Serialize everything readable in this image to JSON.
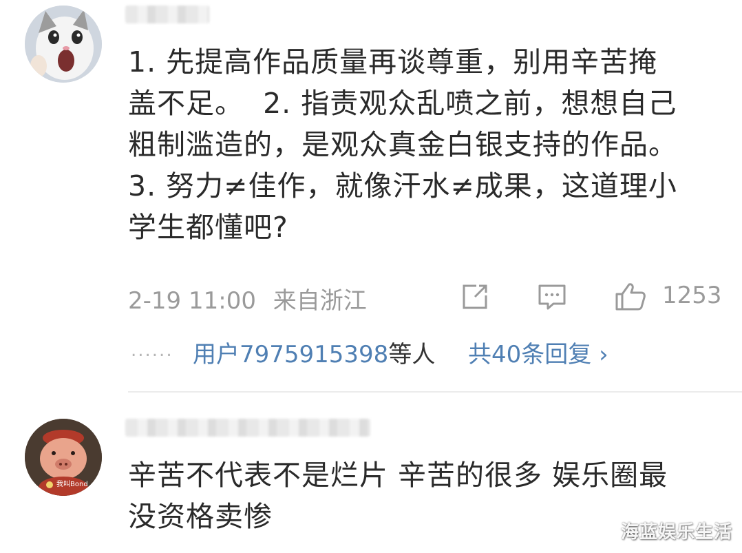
{
  "comments": [
    {
      "avatar": "cat-avatar",
      "text": "1. 先提高作品质量再谈尊重，别用辛苦掩\n盖不足。  2. 指责观众乱喷之前，想想自己\n粗制滥造的，是观众真金白银支持的作品。\n3. 努力≠佳作，就像汗水≠成果，这道理小\n学生都懂吧?",
      "date": "2-19 11:00",
      "location": "来自浙江",
      "like_count": "1253",
      "replies": {
        "dots": "......",
        "users_link": "用户7975915398",
        "users_suffix": "等人",
        "count_label": "共40条回复 ›"
      }
    },
    {
      "avatar": "cartoon-pig-avatar",
      "avatar_caption": "我叫Bond",
      "text": "辛苦不代表不是烂片 辛苦的很多 娱乐圈最\n没资格卖惨"
    }
  ],
  "icons": {
    "share": "share-icon",
    "reply": "comment-icon",
    "like": "thumbs-up-icon"
  },
  "watermark": "海蓝娱乐生活",
  "colors": {
    "link": "#4f7fb3",
    "meta": "#9a9a9a",
    "text": "#2a2a2a"
  }
}
